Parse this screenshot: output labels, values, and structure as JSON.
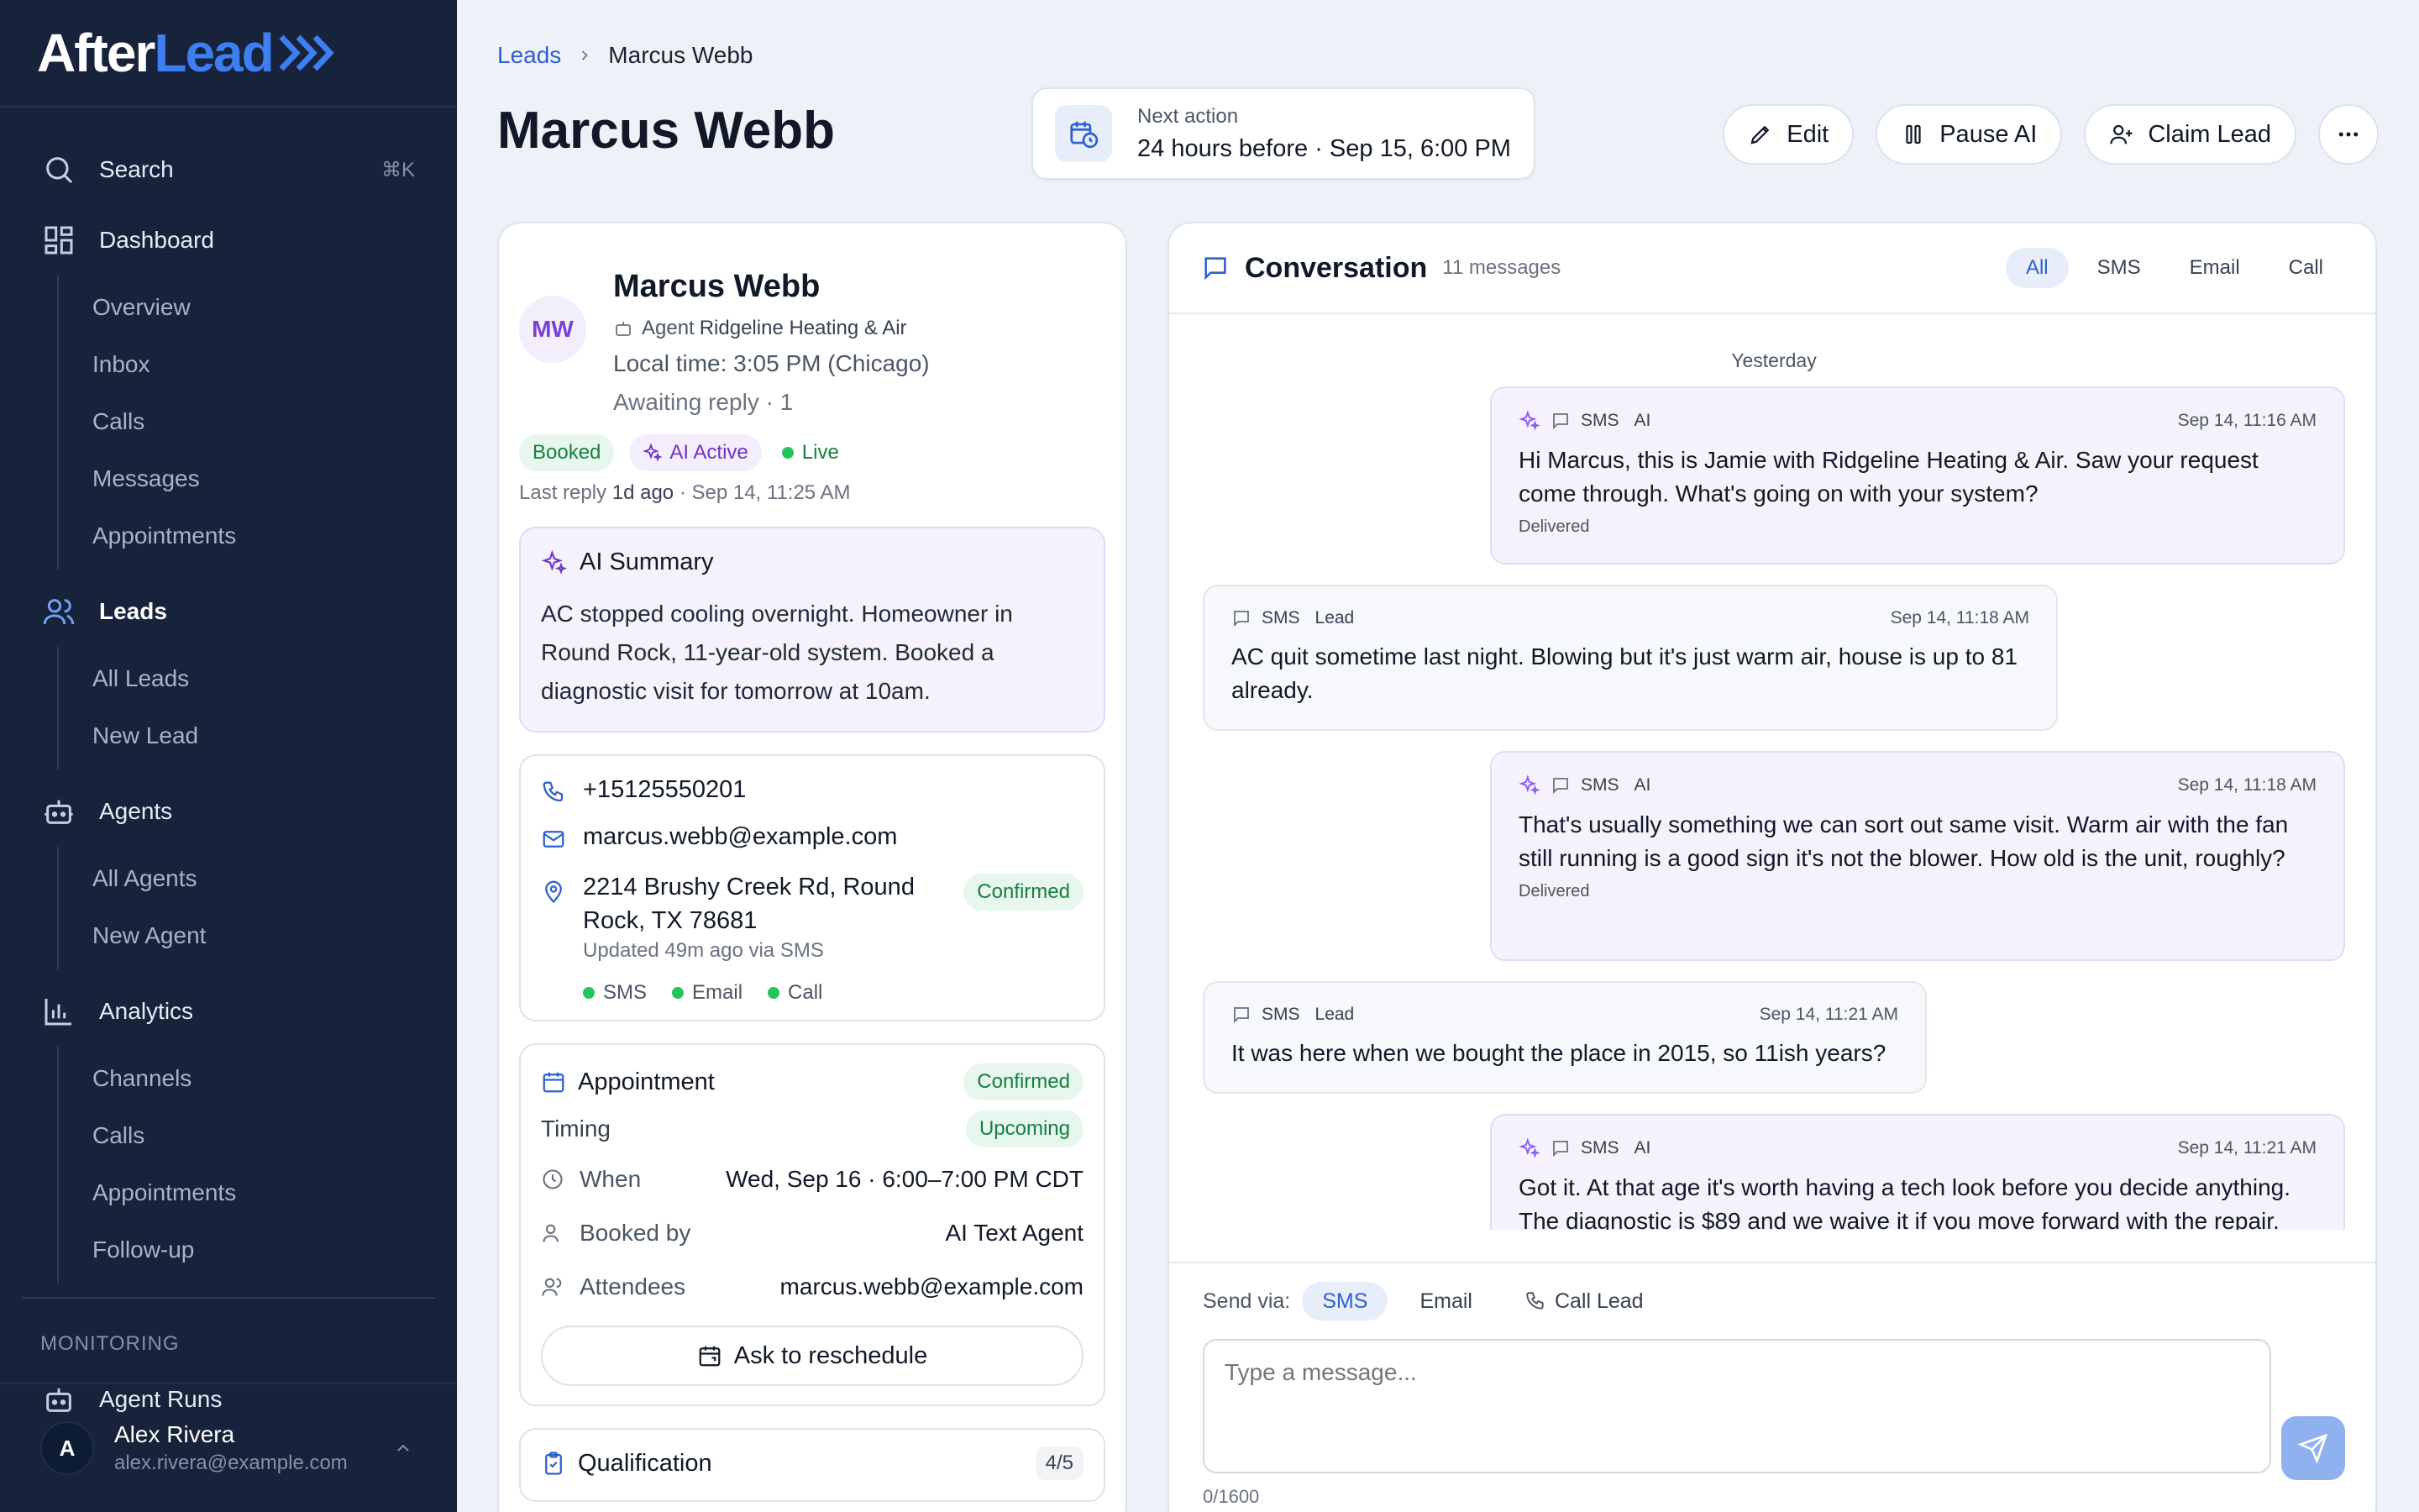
{
  "app": {
    "logo_a": "After",
    "logo_b": "Lead"
  },
  "sidebar": {
    "search_label": "Search",
    "search_kbd": "⌘K",
    "dashboard": {
      "label": "Dashboard",
      "items": [
        "Overview",
        "Inbox",
        "Calls",
        "Messages",
        "Appointments"
      ]
    },
    "leads": {
      "label": "Leads",
      "items": [
        "All Leads",
        "New Lead"
      ]
    },
    "agents": {
      "label": "Agents",
      "items": [
        "All Agents",
        "New Agent"
      ]
    },
    "analytics": {
      "label": "Analytics",
      "items": [
        "Channels",
        "Calls",
        "Appointments",
        "Follow-up"
      ]
    },
    "monitoring_label": "MONITORING",
    "agent_runs": "Agent Runs",
    "user": {
      "initial": "A",
      "name": "Alex Rivera",
      "email": "alex.rivera@example.com"
    }
  },
  "breadcrumb": {
    "parent": "Leads",
    "current": "Marcus Webb"
  },
  "page_title": "Marcus Webb",
  "next_action": {
    "label": "Next action",
    "value": "24 hours before · Sep 15, 6:00 PM"
  },
  "actions": {
    "edit": "Edit",
    "pause": "Pause AI",
    "claim": "Claim Lead"
  },
  "lead": {
    "initials": "MW",
    "name": "Marcus Webb",
    "agent_prefix": "Agent",
    "agent": "Ridgeline Heating & Air",
    "local_time": "Local time: 3:05 PM (Chicago)",
    "awaiting": "Awaiting reply · 1",
    "badges": {
      "booked": "Booked",
      "ai": "AI Active",
      "live": "Live"
    },
    "last_reply_prefix": "Last reply",
    "last_reply_value": "1d ago",
    "last_reply_time": "· Sep 14, 11:25 AM",
    "summary_title": "AI Summary",
    "summary_text": "AC stopped cooling overnight. Homeowner in Round Rock, 11-year-old system. Booked a diagnostic visit for tomorrow at 10am.",
    "phone": "+15125550201",
    "email": "marcus.webb@example.com",
    "address": "2214 Brushy Creek Rd, Round Rock, TX 78681",
    "address_status": "Confirmed",
    "address_updated": "Updated 49m ago via SMS",
    "channels": [
      "SMS",
      "Email",
      "Call"
    ],
    "appointment": {
      "title": "Appointment",
      "status": "Confirmed",
      "timing_label": "Timing",
      "timing_status": "Upcoming",
      "when_label": "When",
      "when_value": "Wed, Sep 16 · 6:00–7:00 PM CDT",
      "booked_label": "Booked by",
      "booked_value": "AI Text Agent",
      "attendees_label": "Attendees",
      "attendees_value": "marcus.webb@example.com",
      "reschedule": "Ask to reschedule"
    },
    "qualification": {
      "title": "Qualification",
      "count": "4/5"
    }
  },
  "conversation": {
    "title": "Conversation",
    "count": "11 messages",
    "filters": [
      "All",
      "SMS",
      "Email",
      "Call"
    ],
    "day": "Yesterday",
    "messages": [
      {
        "channel": "SMS",
        "sender": "AI",
        "time": "Sep 14, 11:16 AM",
        "text": "Hi Marcus, this is Jamie with Ridgeline Heating & Air. Saw your request come through. What's going on with your system?",
        "status": "Delivered"
      },
      {
        "channel": "SMS",
        "sender": "Lead",
        "time": "Sep 14, 11:18 AM",
        "text": "AC quit sometime last night. Blowing but it's just warm air, house is up to 81 already."
      },
      {
        "channel": "SMS",
        "sender": "AI",
        "time": "Sep 14, 11:18 AM",
        "text": "That's usually something we can sort out same visit. Warm air with the fan still running is a good sign it's not the blower. How old is the unit, roughly?",
        "status": "Delivered"
      },
      {
        "channel": "SMS",
        "sender": "Lead",
        "time": "Sep 14, 11:21 AM",
        "text": "It was here when we bought the place in 2015, so 11ish years?"
      },
      {
        "channel": "SMS",
        "sender": "AI",
        "time": "Sep 14, 11:21 AM",
        "text": "Got it. At that age it's worth having a tech look before you decide anything. The diagnostic is $89 and we waive it if you move forward with the repair. What's the property address?"
      }
    ]
  },
  "composer": {
    "send_via": "Send via:",
    "options": [
      "SMS",
      "Email",
      "Call Lead"
    ],
    "placeholder": "Type a message...",
    "counter": "0/1600"
  }
}
